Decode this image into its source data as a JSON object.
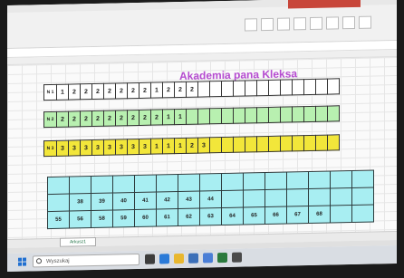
{
  "sheet_title": "Akademia pana Kleksa",
  "row1": {
    "label": "N 1",
    "values": [
      "1",
      "2",
      "2",
      "2",
      "2",
      "2",
      "2",
      "2",
      "1",
      "2",
      "2",
      "2"
    ]
  },
  "row2": {
    "label": "N 2",
    "values": [
      "2",
      "2",
      "2",
      "2",
      "2",
      "2",
      "2",
      "2",
      "2",
      "1",
      "1"
    ]
  },
  "row3": {
    "label": "N 3",
    "values": [
      "3",
      "3",
      "3",
      "3",
      "3",
      "3",
      "3",
      "3",
      "1",
      "1",
      "1",
      "2",
      "3"
    ]
  },
  "bottom_row1": [
    "38",
    "39",
    "40",
    "41",
    "42",
    "43",
    "44"
  ],
  "bottom_row2": [
    "55",
    "56",
    "58",
    "59",
    "60",
    "61",
    "62",
    "63",
    "64",
    "65",
    "66",
    "67",
    "68"
  ],
  "sheet_tab": "Arkusz1",
  "taskbar": {
    "search_placeholder": "Wyszukaj"
  }
}
